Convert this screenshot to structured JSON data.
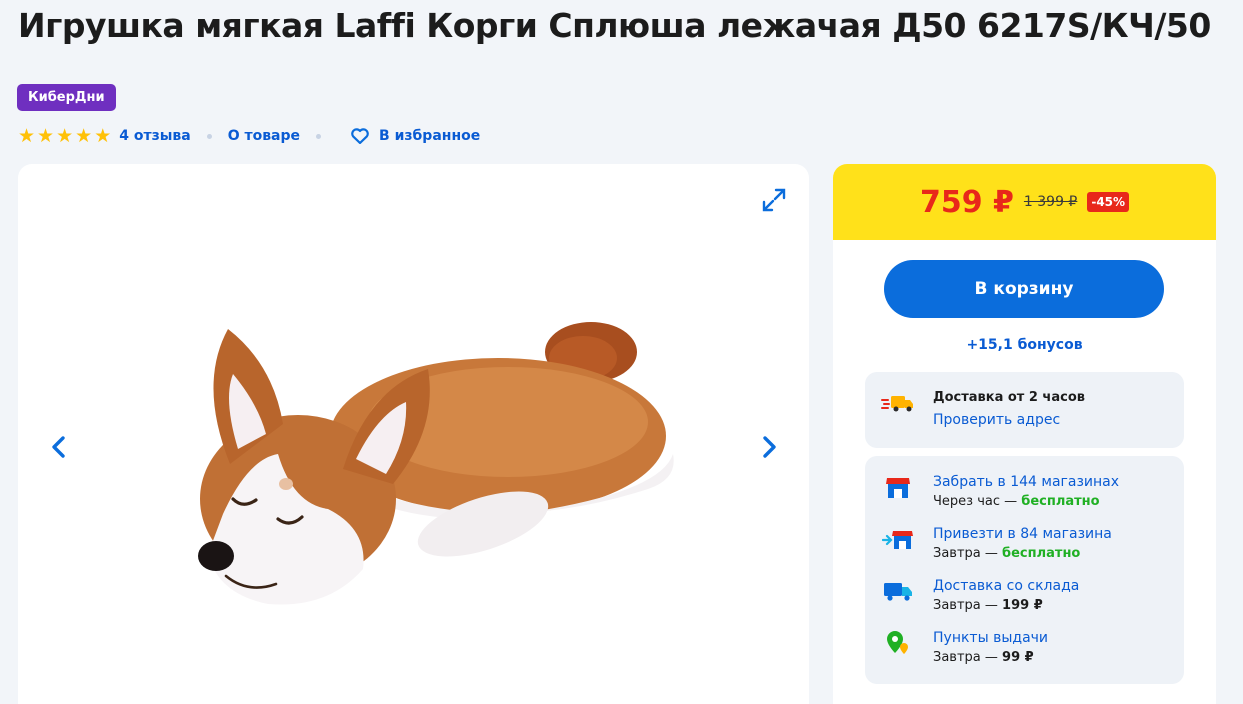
{
  "product": {
    "title": "Игрушка мягкая Laffi Корги Сплюша лежачая Д50 6217S/КЧ/50",
    "badge": "КиберДни",
    "rating": 5,
    "reviews_label": "4 отзыва",
    "about_label": "О товаре",
    "favorite_label": "В избранное"
  },
  "icons": {
    "star": "star-icon",
    "heart": "heart-icon",
    "expand": "expand-icon",
    "prev": "chevron-left-icon",
    "next": "chevron-right-icon",
    "fast_delivery": "fast-truck-icon",
    "store": "store-icon",
    "store_transfer": "store-transfer-icon",
    "warehouse_delivery": "truck-icon",
    "pickup_point": "map-pin-icon"
  },
  "pricing": {
    "price": "759 ₽",
    "old_price": "1 399 ₽",
    "discount": "-45%",
    "cart_label": "В корзину",
    "bonus": "+15,1 бонусов"
  },
  "delivery": {
    "express_title": "Доставка от 2 часов",
    "express_link": "Проверить адрес",
    "options": [
      {
        "title": "Забрать в 144 магазинах",
        "when": "Через час — ",
        "cost": "бесплатно"
      },
      {
        "title": "Привезти в 84 магазина",
        "when": "Завтра — ",
        "cost": "бесплатно"
      },
      {
        "title": "Доставка со склада",
        "when": "Завтра — ",
        "cost": "199 ₽"
      },
      {
        "title": "Пункты выдачи",
        "when": "Завтра — ",
        "cost": "99 ₽"
      }
    ]
  },
  "colors": {
    "accent_blue": "#0b6ddc",
    "price_red": "#e8281a",
    "price_bar_yellow": "#ffe11a",
    "promo_purple": "#6f2fc0",
    "free_green": "#20b024",
    "star_yellow": "#ffc107"
  }
}
